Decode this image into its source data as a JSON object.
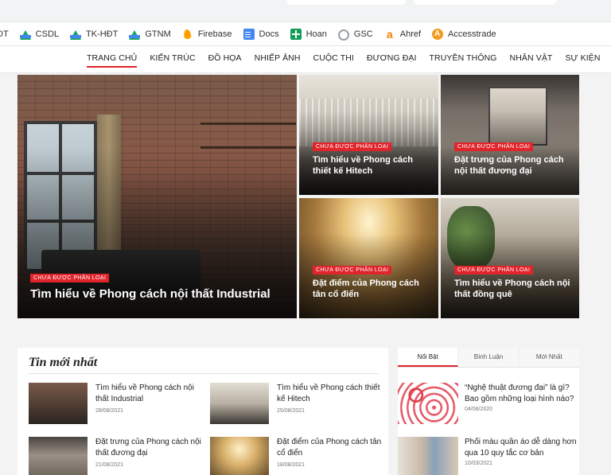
{
  "bookmarks": [
    {
      "label": "DT",
      "icon": "drive-icon"
    },
    {
      "label": "CSDL",
      "icon": "drive-icon"
    },
    {
      "label": "TK-HĐT",
      "icon": "drive-icon"
    },
    {
      "label": "GTNM",
      "icon": "drive-icon"
    },
    {
      "label": "Firebase",
      "icon": "firebase-icon"
    },
    {
      "label": "Docs",
      "icon": "docs-icon"
    },
    {
      "label": "Hoan",
      "icon": "plus-icon"
    },
    {
      "label": "GSC",
      "icon": "gsc-icon"
    },
    {
      "label": "Ahref",
      "icon": "ahrefs-icon"
    },
    {
      "label": "Accesstrade",
      "icon": "accesstrade-icon"
    }
  ],
  "nav": {
    "items": [
      "TRANG CHỦ",
      "KIẾN TRÚC",
      "ĐỒ HỌA",
      "NHIẾP ẢNH",
      "CUỘC THI",
      "ĐƯƠNG ĐẠI",
      "TRUYỀN THÔNG",
      "NHÂN VẬT",
      "SỰ KIỆN"
    ],
    "active": "TRANG CHỦ"
  },
  "hero": {
    "big": {
      "badge": "CHƯA ĐƯỢC PHÂN LOẠI",
      "title": "Tìm hiểu về Phong cách nội thất Industrial"
    },
    "small": [
      {
        "badge": "CHƯA ĐƯỢC PHÂN LOẠI",
        "title": "Tìm hiểu về Phong cách thiết kế Hitech"
      },
      {
        "badge": "CHƯA ĐƯỢC PHÂN LOẠI",
        "title": "Đặt trưng của Phong cách nội thất đương đại"
      },
      {
        "badge": "CHƯA ĐƯỢC PHÂN LOẠI",
        "title": "Đặt điểm của Phong cách tân cổ điển"
      },
      {
        "badge": "CHƯA ĐƯỢC PHÂN LOẠI",
        "title": "Tìm hiểu về Phong cách nội thất đồng quê"
      }
    ]
  },
  "latest": {
    "heading": "Tin mới nhất",
    "items": [
      {
        "title": "Tìm hiểu về Phong cách nội thất Industrial",
        "date": "28/08/2021"
      },
      {
        "title": "Tìm hiểu về Phong cách thiết kế Hitech",
        "date": "25/08/2021"
      },
      {
        "title": "Đặt trưng của Phong cách nội thất đương đại",
        "date": "21/08/2021"
      },
      {
        "title": "Đặt điểm của Phong cách tân cổ điển",
        "date": "18/08/2021"
      }
    ]
  },
  "sidebar": {
    "tabs": [
      "Nổi Bật",
      "Bình Luận",
      "Mới Nhất"
    ],
    "active_tab": "Nổi Bật",
    "items": [
      {
        "title": "“Nghệ thuật đương đại” là gì? Bao gồm những loại hình nào?",
        "date": "04/08/2020"
      },
      {
        "title": "Phối màu quần áo dễ dàng hơn qua 10 quy tắc cơ bản",
        "date": "10/03/2021"
      }
    ]
  },
  "colors": {
    "accent": "#e0242b",
    "panel": "#ffffff",
    "page_bg": "#f3f3f3"
  }
}
